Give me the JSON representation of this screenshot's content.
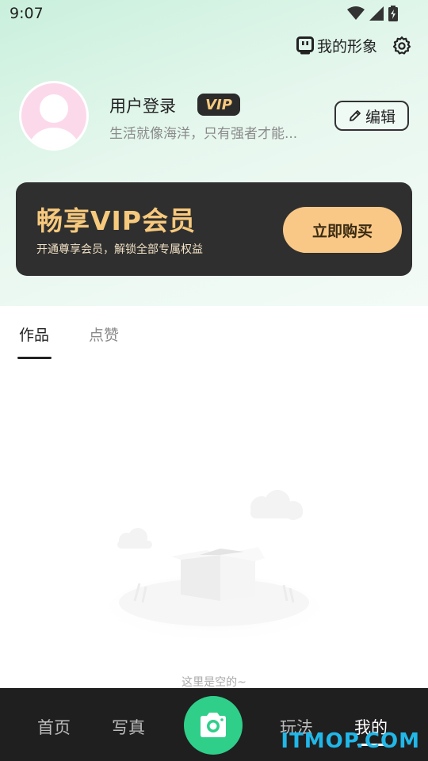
{
  "status_bar": {
    "time": "9:07"
  },
  "header": {
    "avatar_label": "我的形象"
  },
  "profile": {
    "username": "用户登录",
    "vip_badge": "VIP",
    "motto": "生活就像海洋，只有强者才能...",
    "edit_label": "编辑"
  },
  "vip_card": {
    "title": "畅享VIP会员",
    "subtitle": "开通尊享会员，解锁全部专属权益",
    "buy_label": "立即购买"
  },
  "tabs": [
    {
      "label": "作品",
      "active": true
    },
    {
      "label": "点赞",
      "active": false
    }
  ],
  "empty_state": {
    "text": "这里是空的~"
  },
  "bottom_nav": {
    "items": [
      {
        "label": "首页"
      },
      {
        "label": "写真"
      },
      {
        "label": "玩法"
      },
      {
        "label": "我的"
      }
    ],
    "active": "我的"
  },
  "watermark": "ITMOP.COM",
  "colors": {
    "accent": "#2fcf8a",
    "vip_gold": "#f7c97d",
    "nav_bg": "#1f1f1f"
  }
}
